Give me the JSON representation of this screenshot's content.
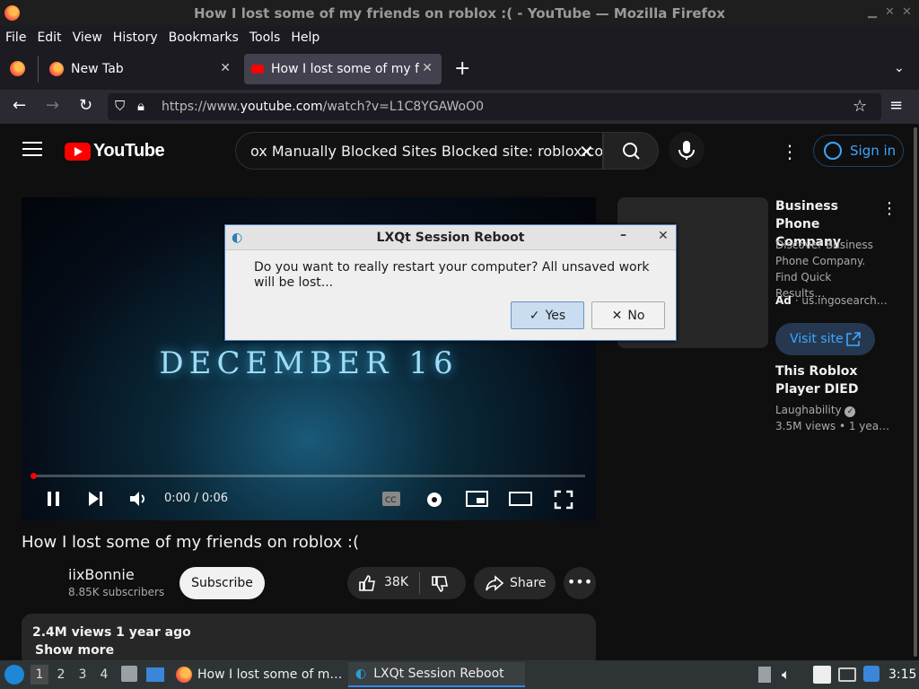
{
  "window": {
    "title": "How I lost some of my friends on roblox :( - YouTube — Mozilla Firefox"
  },
  "menubar": [
    "File",
    "Edit",
    "View",
    "History",
    "Bookmarks",
    "Tools",
    "Help"
  ],
  "tabs": [
    {
      "label": "New Tab"
    },
    {
      "label": "How I lost some of my friends on roblox :( - YouTube"
    }
  ],
  "urlbar": {
    "prefix": "https://www.",
    "domain": "youtube.com",
    "path": "/watch?v=L1C8YGAWoO0"
  },
  "youtube": {
    "logo_text": "YouTube",
    "search_value": "ox Manually Blocked Sites Blocked site: roblox.com",
    "sign_in": "Sign in",
    "video": {
      "overlay_text": "DECEMBER 16",
      "time": "0:00 / 0:06",
      "progress": 0
    },
    "title": "How I lost some of my friends on roblox :(",
    "channel": "iixBonnie",
    "subscribers": "8.85K subscribers",
    "subscribe_label": "Subscribe",
    "likes": "38K",
    "share_label": "Share",
    "views_date": "2.4M views  1 year ago",
    "show_more": "Show more",
    "ad": {
      "title": "Business Phone Company",
      "description": "Discover Business Phone Company. Find Quick Results…",
      "badge": "Ad",
      "source": "us.ingosearch…",
      "visit_label": "Visit site"
    },
    "recommended": {
      "title": "This Roblox Player DIED",
      "channel": "Laughability",
      "meta": "3.5M views  • 1 yea…"
    }
  },
  "dialog": {
    "title": "LXQt Session Reboot",
    "message": "Do you want to really restart your computer? All unsaved work will be lost...",
    "yes_label": "Yes",
    "no_label": "No"
  },
  "taskbar": {
    "workspaces": [
      "1",
      "2",
      "3",
      "4"
    ],
    "task_firefox": "How I lost some of m…",
    "task_dialog": "LXQt Session Reboot",
    "clock": "3:15"
  }
}
